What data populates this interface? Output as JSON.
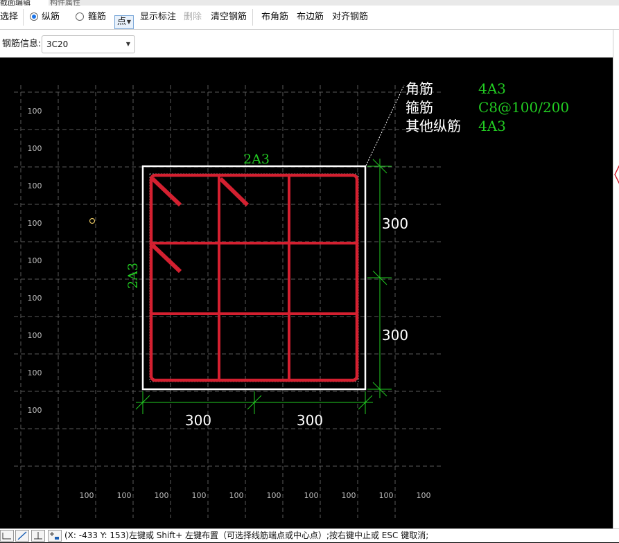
{
  "tabs": [
    {
      "label": "截面编辑",
      "active": true
    },
    {
      "label": "构件属性",
      "active": false
    }
  ],
  "toolbar": {
    "select_label": "选择",
    "radio_longitudinal": {
      "label": "纵筋",
      "checked": true
    },
    "radio_stirrup": {
      "label": "箍筋",
      "checked": false
    },
    "point_dropdown": "点",
    "show_dim_label": "显示标注",
    "delete_label": "删除",
    "clear_rebar_label": "清空钢筋",
    "corner_rebar_label": "布角筋",
    "side_rebar_label": "布边筋",
    "align_rebar_label": "对齐钢筋"
  },
  "rebar_info": {
    "label": "钢筋信息:",
    "value": "3C20"
  },
  "section": {
    "top_side_label": "2A3",
    "left_side_label": "2A3",
    "legend": [
      {
        "name": "角筋",
        "value": "4A3"
      },
      {
        "name": "箍筋",
        "value": "C8@100/200"
      },
      {
        "name": "其他纵筋",
        "value": "4A3"
      }
    ],
    "dims_right": [
      "300",
      "300"
    ],
    "dims_bottom": [
      "300",
      "300"
    ]
  },
  "grid": {
    "left_labels": [
      "100",
      "100",
      "100",
      "100",
      "100",
      "100",
      "100",
      "100",
      "100"
    ],
    "bottom_labels": [
      "100",
      "100",
      "100",
      "100",
      "100",
      "100",
      "100",
      "100",
      "100",
      "100"
    ]
  },
  "status": {
    "text": "(X: -433 Y: 153)左键或 Shift+ 左键布置（可选择线筋端点或中心点）;按右键中止或 ESC 键取消;"
  },
  "colors": {
    "background": "#000000",
    "section_outline": "#ffffff",
    "rebar": "#d42030",
    "dimension": "#22cc22",
    "grid": "#5a5a5a",
    "annotation_text": "#ffffff"
  }
}
